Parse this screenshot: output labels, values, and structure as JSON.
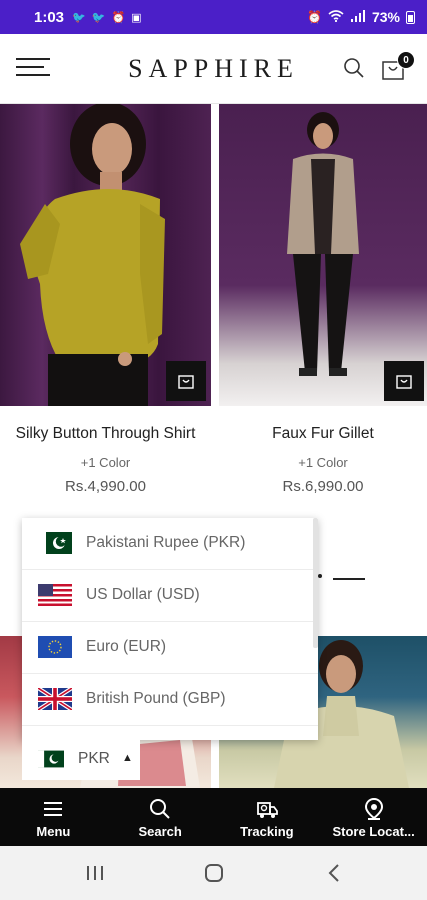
{
  "status_bar": {
    "time": "1:03",
    "battery": "73%",
    "left_icons": [
      "twitter-icon",
      "twitter-icon",
      "alarm-icon",
      "gallery-icon"
    ],
    "right_icons": [
      "alarm-icon",
      "wifi-icon",
      "signal-icon",
      "battery-icon"
    ]
  },
  "header": {
    "brand": "SAPPHIRE",
    "cart_count": "0"
  },
  "products": [
    {
      "name": "Silky Button Through Shirt",
      "colors": "+1 Color",
      "price": "Rs.4,990.00"
    },
    {
      "name": "Faux Fur Gillet",
      "colors": "+1 Color",
      "price": "Rs.6,990.00"
    }
  ],
  "currency_menu": {
    "options": [
      {
        "label": "Pakistani Rupee (PKR)",
        "flag": "pakistan-flag"
      },
      {
        "label": "US Dollar (USD)",
        "flag": "usa-flag"
      },
      {
        "label": "Euro (EUR)",
        "flag": "eu-flag"
      },
      {
        "label": "British Pound (GBP)",
        "flag": "uk-flag"
      }
    ],
    "selected": "PKR"
  },
  "bottom_nav": [
    {
      "label": "Menu",
      "icon": "menu-icon"
    },
    {
      "label": "Search",
      "icon": "search-icon"
    },
    {
      "label": "Tracking",
      "icon": "delivery-truck-icon"
    },
    {
      "label": "Store Locat...",
      "icon": "location-pin-icon"
    }
  ],
  "colors": {
    "status_bar": "#4b1fc8",
    "nav_bg": "#0a0a0a",
    "accent": "#111111"
  }
}
